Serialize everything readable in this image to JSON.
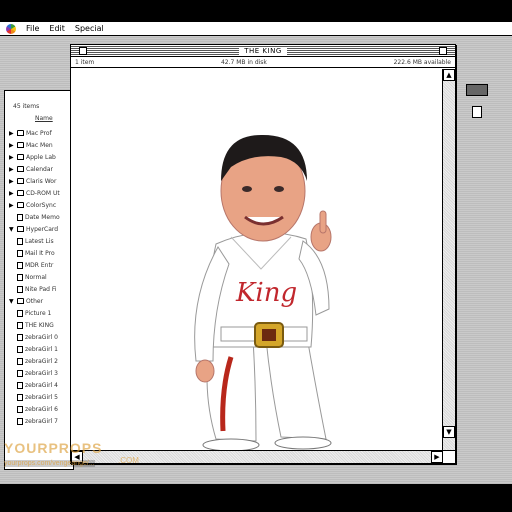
{
  "menubar": {
    "items": [
      "File",
      "Edit",
      "Special"
    ]
  },
  "background_window": {
    "item_count": "45 items",
    "column_header": "Name",
    "rows": [
      {
        "tri": "▶",
        "type": "folder",
        "label": "Mac Prof"
      },
      {
        "tri": "▶",
        "type": "folder",
        "label": "Mac Men"
      },
      {
        "tri": "▶",
        "type": "folder",
        "label": "Apple Lab"
      },
      {
        "tri": "▶",
        "type": "folder",
        "label": "Calendar"
      },
      {
        "tri": "▶",
        "type": "folder",
        "label": "Claris Wor"
      },
      {
        "tri": "▶",
        "type": "folder",
        "label": "CD-ROM Ut"
      },
      {
        "tri": "▶",
        "type": "folder",
        "label": "ColorSync"
      },
      {
        "tri": "",
        "type": "app",
        "label": "Date Memo"
      },
      {
        "tri": "▼",
        "type": "folder",
        "label": "HyperCard"
      },
      {
        "tri": "",
        "type": "doc",
        "label": "Latest Lis"
      },
      {
        "tri": "",
        "type": "doc",
        "label": "Mail It Pro"
      },
      {
        "tri": "",
        "type": "doc",
        "label": "MDR Entr"
      },
      {
        "tri": "",
        "type": "doc",
        "label": "Normal"
      },
      {
        "tri": "",
        "type": "doc",
        "label": "Nite Pad Fi"
      },
      {
        "tri": "▼",
        "type": "folder",
        "label": "Other"
      },
      {
        "tri": "",
        "type": "doc",
        "label": "Picture 1"
      },
      {
        "tri": "",
        "type": "doc",
        "label": "THE KING"
      },
      {
        "tri": "",
        "type": "doc",
        "label": "zebraGirl 0"
      },
      {
        "tri": "",
        "type": "doc",
        "label": "zebraGirl 1"
      },
      {
        "tri": "",
        "type": "doc",
        "label": "zebraGirl 2"
      },
      {
        "tri": "",
        "type": "doc",
        "label": "zebraGirl 3"
      },
      {
        "tri": "",
        "type": "doc",
        "label": "zebraGirl 4"
      },
      {
        "tri": "",
        "type": "doc",
        "label": "zebraGirl 5"
      },
      {
        "tri": "",
        "type": "doc",
        "label": "zebraGirl 6"
      },
      {
        "tri": "",
        "type": "doc",
        "label": "zebraGirl 7"
      }
    ]
  },
  "main_window": {
    "title": "THE KING",
    "info_left": "1 item",
    "info_center": "42.7 MB in disk",
    "info_right": "222.6 MB available",
    "image_text": "King"
  },
  "watermark": {
    "brand": "YOURPROPS",
    "dotcom": ".COM",
    "url": "yourprops.com/vengeange/..."
  },
  "colors": {
    "suit": "#ffffff",
    "belt": "#d4a62a",
    "stripe": "#b8271b",
    "lettering": "#c1272d",
    "skin": "#e8a385"
  }
}
